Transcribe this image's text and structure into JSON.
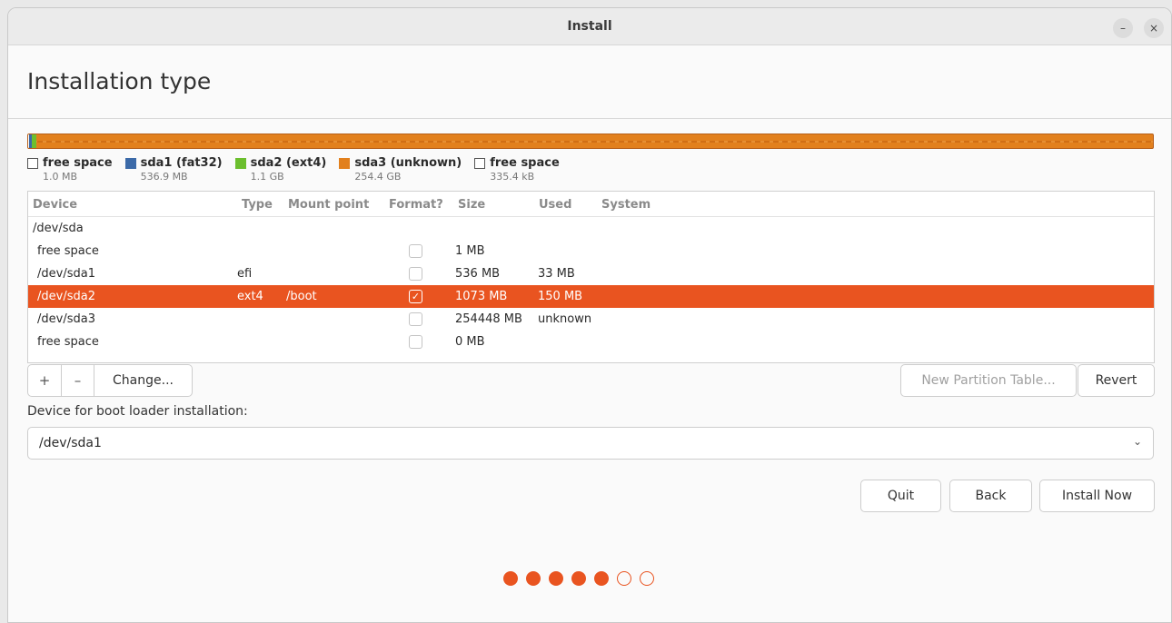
{
  "window": {
    "title": "Install",
    "minimize_glyph": "–",
    "close_glyph": "×"
  },
  "page": {
    "title": "Installation type"
  },
  "legend": [
    {
      "label": "free space",
      "size": "1.0 MB",
      "color": "#ffffff"
    },
    {
      "label": "sda1 (fat32)",
      "size": "536.9 MB",
      "color": "#3c6aa8"
    },
    {
      "label": "sda2 (ext4)",
      "size": "1.1 GB",
      "color": "#6cbf2e"
    },
    {
      "label": "sda3 (unknown)",
      "size": "254.4 GB",
      "color": "#e2801d"
    },
    {
      "label": "free space",
      "size": "335.4 kB",
      "color": "#ffffff"
    }
  ],
  "table": {
    "headers": {
      "device": "Device",
      "type": "Type",
      "mount": "Mount point",
      "format": "Format?",
      "size": "Size",
      "used": "Used",
      "system": "System"
    },
    "rows": [
      {
        "device": "/dev/sda",
        "type": "",
        "mount": "",
        "format": null,
        "size": "",
        "used": ""
      },
      {
        "device": "free space",
        "type": "",
        "mount": "",
        "format": false,
        "size": "1 MB",
        "used": ""
      },
      {
        "device": "/dev/sda1",
        "type": "efi",
        "mount": "",
        "format": false,
        "size": "536 MB",
        "used": "33 MB"
      },
      {
        "device": "/dev/sda2",
        "type": "ext4",
        "mount": "/boot",
        "format": true,
        "size": "1073 MB",
        "used": "150 MB"
      },
      {
        "device": "/dev/sda3",
        "type": "",
        "mount": "",
        "format": false,
        "size": "254448 MB",
        "used": "unknown"
      },
      {
        "device": "free space",
        "type": "",
        "mount": "",
        "format": false,
        "size": "0 MB",
        "used": ""
      }
    ]
  },
  "partition_buttons": {
    "add": "+",
    "remove": "–",
    "change": "Change...",
    "new_table": "New Partition Table...",
    "revert": "Revert"
  },
  "bootloader": {
    "label": "Device for boot loader installation:",
    "value": "/dev/sda1"
  },
  "actions": {
    "quit": "Quit",
    "back": "Back",
    "install": "Install Now"
  },
  "progress": {
    "total_steps": 7,
    "completed_steps": 5
  },
  "colors": {
    "accent": "#e95420"
  }
}
